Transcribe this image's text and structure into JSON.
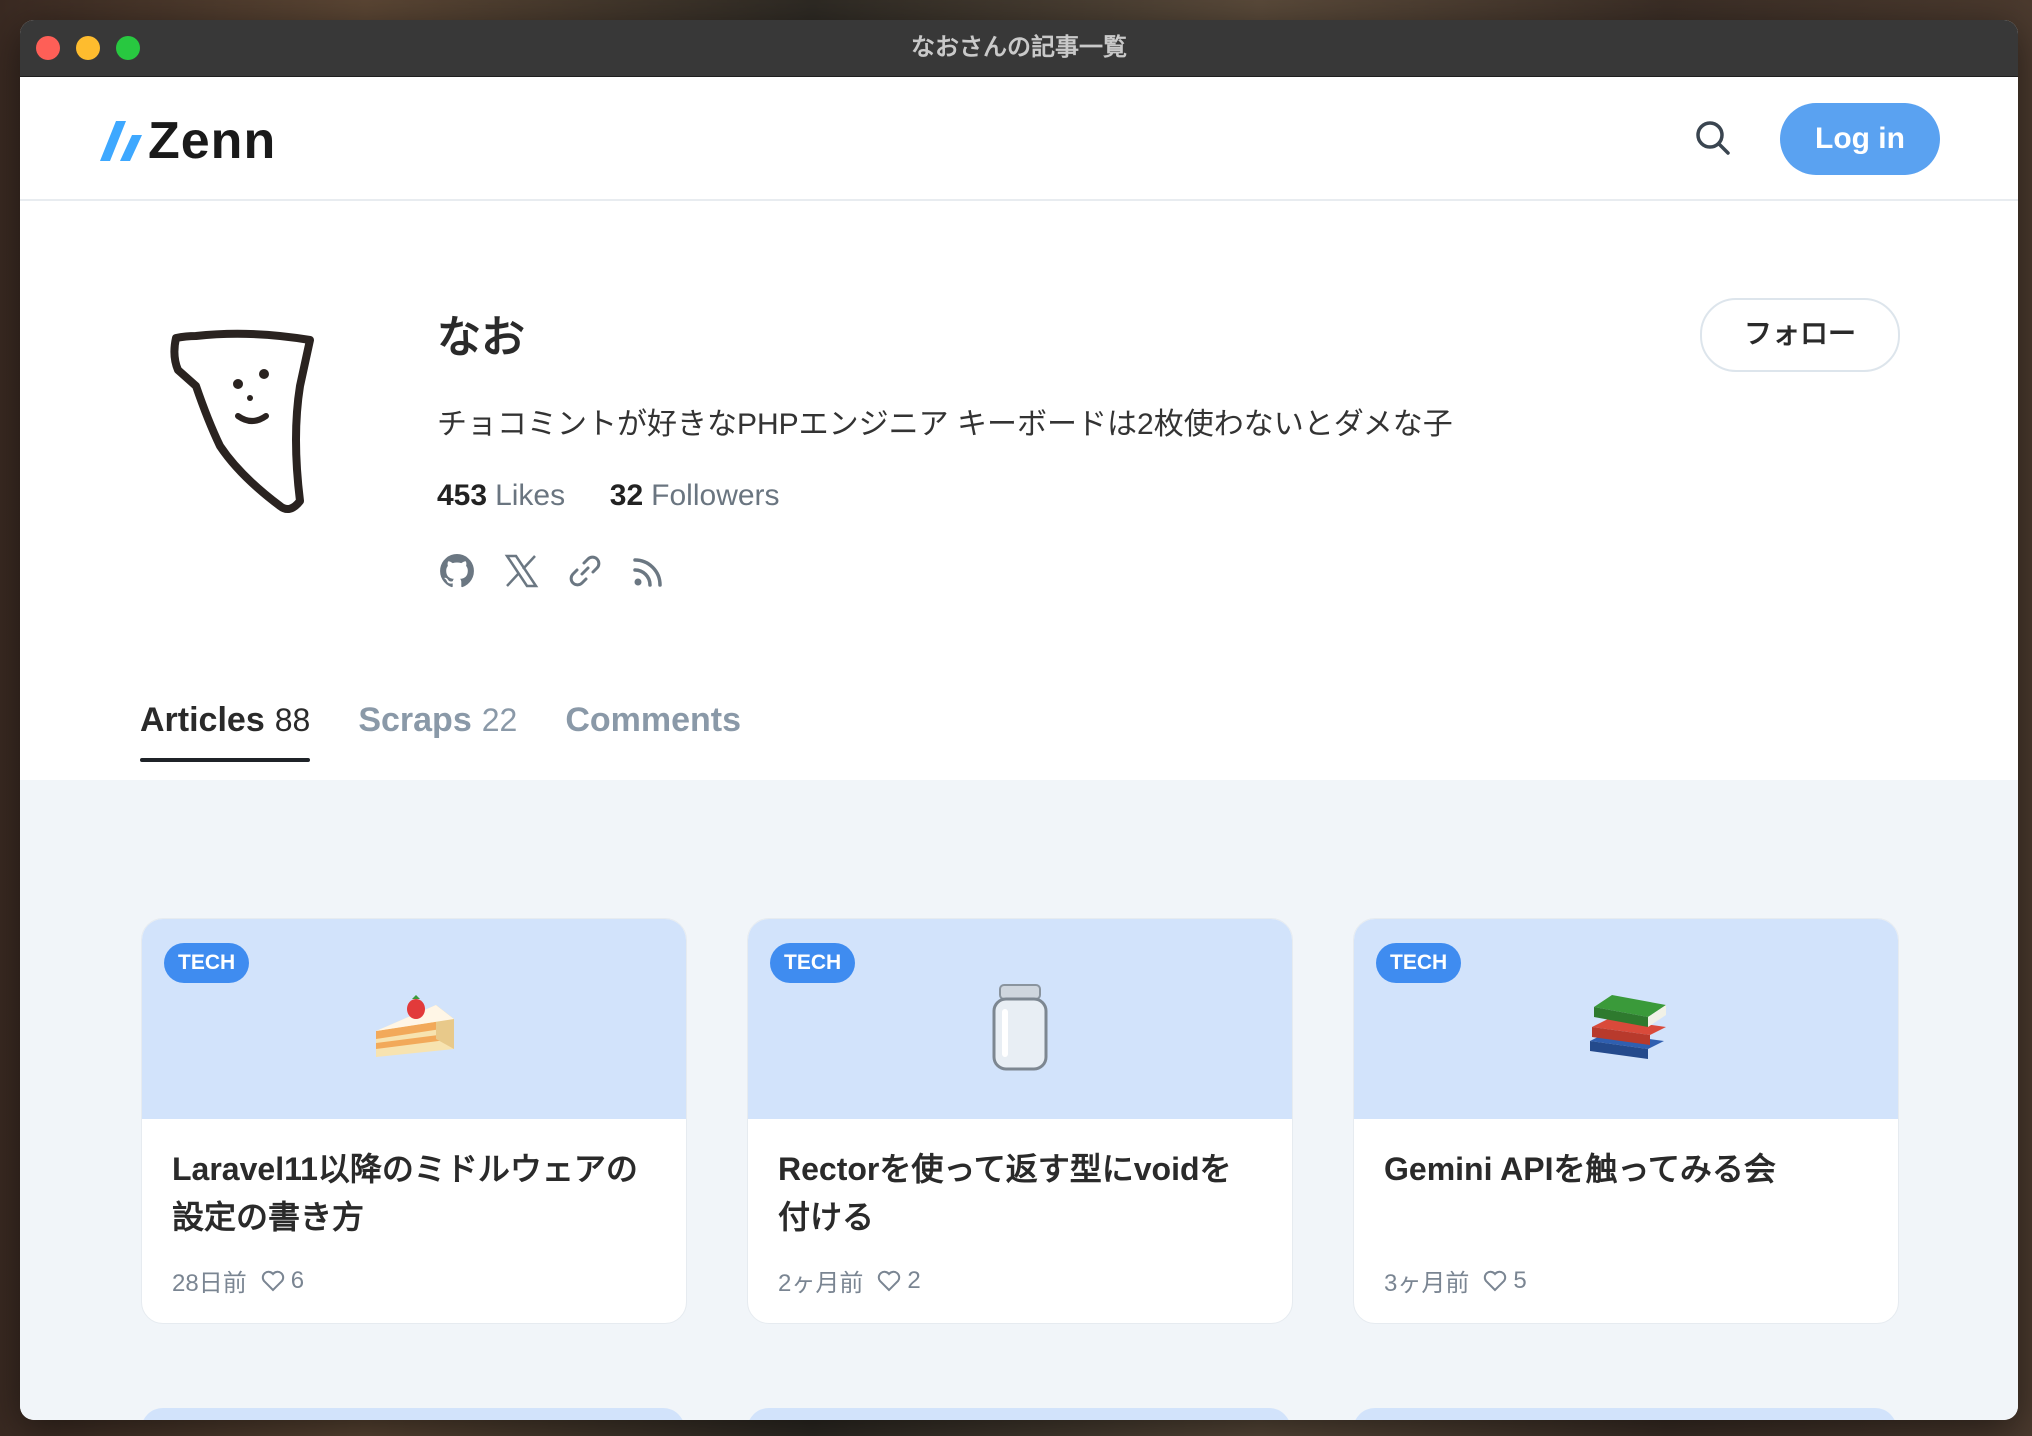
{
  "window": {
    "title": "なおさんの記事一覧"
  },
  "header": {
    "logo_text": "Zenn",
    "search_icon": "search-icon",
    "login_label": "Log in",
    "accent_color": "#5aa2f1"
  },
  "profile": {
    "name": "なお",
    "bio": "チョコミントが好きなPHPエンジニア キーボードは2枚使わないとダメな子",
    "likes_count": "453",
    "likes_label": "Likes",
    "followers_count": "32",
    "followers_label": "Followers",
    "follow_label": "フォロー",
    "social_icons": [
      "github-icon",
      "x-icon",
      "link-icon",
      "rss-icon"
    ]
  },
  "tabs": [
    {
      "label": "Articles",
      "count": "88",
      "active": true
    },
    {
      "label": "Scraps",
      "count": "22",
      "active": false
    },
    {
      "label": "Comments",
      "count": "",
      "active": false
    }
  ],
  "articles": [
    {
      "badge": "TECH",
      "emoji": "cake-icon",
      "title": "Laravel11以降のミドルウェアの設定の書き方",
      "time": "28日前",
      "likes": "6"
    },
    {
      "badge": "TECH",
      "emoji": "jar-icon",
      "title": "Rectorを使って返す型にvoidを付ける",
      "time": "2ヶ月前",
      "likes": "2"
    },
    {
      "badge": "TECH",
      "emoji": "books-icon",
      "title": "Gemini APIを触ってみる会",
      "time": "3ヶ月前",
      "likes": "5"
    }
  ]
}
